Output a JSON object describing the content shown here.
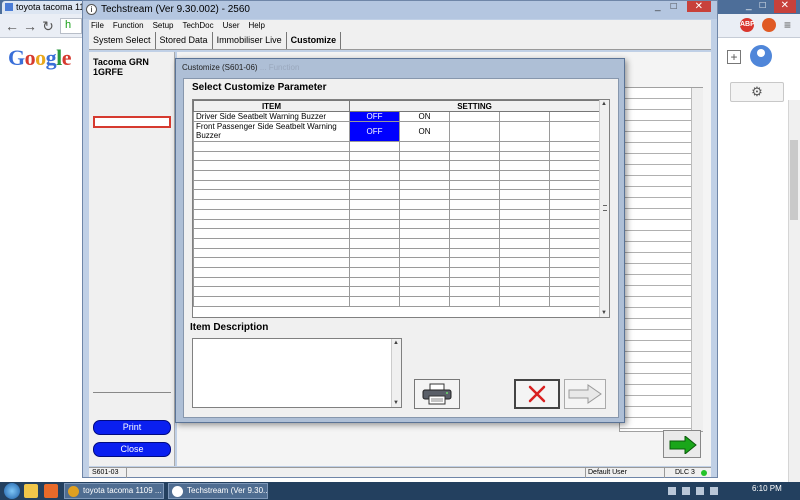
{
  "chrome": {
    "tab_title": "toyota tacoma 11",
    "window_controls": [
      "_",
      "□",
      "✕"
    ],
    "address_visible": "h"
  },
  "google": {
    "logo_letters": [
      "G",
      "o",
      "o",
      "g",
      "l",
      "e"
    ]
  },
  "techstream": {
    "title": "Techstream (Ver 9.30.002) - 2560",
    "menu": [
      "File",
      "Function",
      "Setup",
      "TechDoc",
      "User",
      "Help"
    ],
    "tabs": [
      "System Select",
      "Stored Data",
      "Immobiliser Live",
      "Customize"
    ],
    "active_tab": "Customize",
    "vehicle": {
      "name": "Tacoma GRN",
      "engine": "1GRFE"
    },
    "print_label": "Print",
    "close_label": "Close",
    "status": {
      "code": "S601-03",
      "user": "Default User",
      "dlc": "DLC 3"
    }
  },
  "dialog": {
    "title_prefix": "Customize (S601-06)",
    "title_blurred": "... Function",
    "heading": "Select Customize Parameter",
    "columns": {
      "item": "ITEM",
      "setting": "SETTING"
    },
    "rows": [
      {
        "item": "Driver Side Seatbelt Warning Buzzer",
        "selected": "OFF",
        "other": "ON"
      },
      {
        "item": "Front Passenger Side Seatbelt Warning Buzzer",
        "selected": "OFF",
        "other": "ON"
      }
    ],
    "empty_rows": 17,
    "description_heading": "Item Description",
    "description_text": ""
  },
  "taskbar": {
    "tasks": [
      "toyota tacoma 1109 ...",
      "Techstream (Ver 9.30..."
    ],
    "clock": "6:10 PM"
  },
  "colors": {
    "selected_cell": "#0000ff",
    "pill_button": "#0a1ff0",
    "status_led": "#22c32a",
    "cancel_x": "#d92020",
    "next_arrow": "#1aa61a"
  },
  "icons": {
    "print": "printer-icon",
    "cancel": "red-x-icon",
    "next": "right-arrow-icon"
  }
}
